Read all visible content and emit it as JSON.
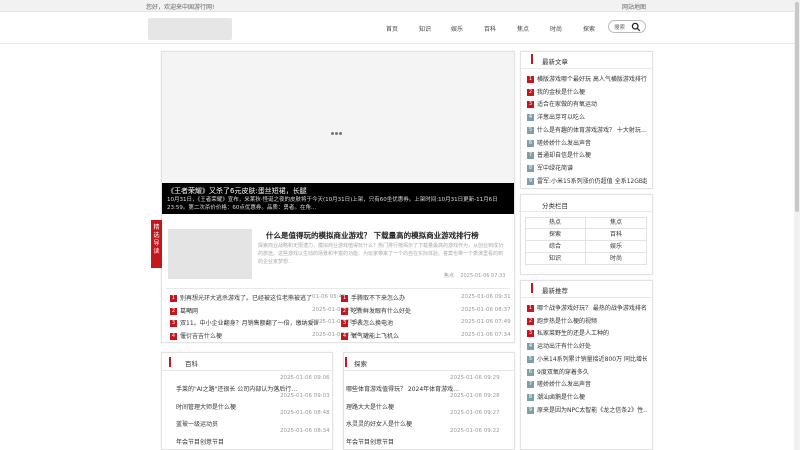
{
  "topbar": {
    "welcome": "您好，欢迎来中国游行网!",
    "sitemap": "网站地图"
  },
  "nav": {
    "items": [
      "首页",
      "知识",
      "娱乐",
      "百科",
      "焦点",
      "时尚",
      "探索"
    ]
  },
  "search": {
    "label": "搜索"
  },
  "slider": {
    "title": "《王者荣耀》又杀了6元皮肤:蛋丝短裙，长腿",
    "desc": "10月31日，《王者荣耀》宣布，米莱狄·怪诞之夜的皮肤将于今天(10月31日)上架，只有60坐优惠券。上架时间:10月31日更新-11月6日23:59。第二次杀价价格：60点优惠券。品质：勇者。在角…"
  },
  "featured": {
    "badge": "精选导读",
    "title": "什么是值得玩的模拟商业游戏？ 下载量高的模拟商业游戏排行榜",
    "desc": "探索商业战略和无限潜力，模拟商业游戏值得玩什么？热门排行榜揭示了下载量最高的游戏作为，从创业到成功的旅途。这些游戏以生动的场景和丰富的功能、为玩家带来了一个的自在实际体验。答案也带一个表演里看的到的企业家梦想…",
    "tag": "焦点",
    "date": "2025-01-06 07:33"
  },
  "left_news": [
    {
      "n": "1",
      "text": "别再想光环大逃杀游戏了。已经被这位老熊被逃了",
      "date": "01-06 05:45"
    },
    {
      "n": "2",
      "text": "葛嗮网",
      "date": "2025-01-06 08:45"
    },
    {
      "n": "3",
      "text": "双11。中小企业翻身？月销售额翻了一倍，缴纳爱国",
      "date": "2025-01-06 08:17"
    },
    {
      "n": "4",
      "text": "偃衍吉吉什么梗",
      "date": "2025-01-06 07:45"
    }
  ],
  "right_news": [
    {
      "n": "1",
      "text": "手腾取不下来怎么办",
      "date": "2025-01-06 09:31"
    },
    {
      "n": "2",
      "text": "吃新鲜发眼有什么好处",
      "date": "2025-01-06 08:37"
    },
    {
      "n": "3",
      "text": "手表怎么换电池",
      "date": "2025-01-06 07:49"
    },
    {
      "n": "4",
      "text": "氧气罐能上飞机么",
      "date": "2025-01-06 07:34"
    }
  ],
  "section_baike": {
    "title": "百科",
    "items": [
      {
        "date": "2025-01-06 09:06",
        "text": "手莱的\"AI之路\"还很长 公司内部认为落后行…"
      },
      {
        "date": "2025-01-06 09:03",
        "text": "时间管理大师是什么梗"
      },
      {
        "date": "2025-01-06 08:48",
        "text": "蓝玻一级运动员"
      },
      {
        "date": "2025-01-06 08:34",
        "text": "年会节目创意节目"
      }
    ]
  },
  "section_tansuo": {
    "title": "探索",
    "items": [
      {
        "date": "2025-01-06 09:29",
        "text": "哪些体育游戏值得玩？ 2024年体育游戏…"
      },
      {
        "date": "2025-01-06 09:28",
        "text": "理路大大是什么梗"
      },
      {
        "date": "2025-01-06 09:27",
        "text": "水灵灵的好女人是什么梗"
      },
      {
        "date": "2025-01-06 09:22",
        "text": "年会节目创意节目"
      }
    ]
  },
  "latest": {
    "title": "最新文章",
    "items": [
      {
        "n": "1",
        "text": "横版游戏哪个最好玩 高人气横版游戏排行"
      },
      {
        "n": "2",
        "text": "我的金秋是什么梗"
      },
      {
        "n": "3",
        "text": "适合在家做的有氧运动"
      },
      {
        "n": "4",
        "text": "洋葱出芽可以吃么"
      },
      {
        "n": "5",
        "text": "什么是有趣的体育游戏游戏？ 十大射玩…"
      },
      {
        "n": "6",
        "text": "嗟娇娇什么发出声音"
      },
      {
        "n": "7",
        "text": "普通却自信是什么梗"
      },
      {
        "n": "8",
        "text": "军中绿花简谱"
      },
      {
        "n": "9",
        "text": "雷军:小米15系列涨价仍超值 全系12GB起"
      }
    ]
  },
  "categories": {
    "title": "分类栏目",
    "cells": [
      "热点",
      "焦点",
      "探索",
      "百科",
      "综合",
      "娱乐",
      "知识",
      "时尚"
    ]
  },
  "recommend": {
    "title": "最新推荐",
    "items": [
      {
        "n": "1",
        "text": "哪个战争游戏好玩？ 最热的战争游戏排名"
      },
      {
        "n": "2",
        "text": "跑步热是什么梗的视频"
      },
      {
        "n": "3",
        "text": "私家菜野生的还是人工种的"
      },
      {
        "n": "4",
        "text": "运动出汗有什么好处"
      },
      {
        "n": "5",
        "text": "小米14系列累计销量接近800万 同比增长…"
      },
      {
        "n": "6",
        "text": "9度双氧的穿着多久"
      },
      {
        "n": "7",
        "text": "嗟娇娇什么发出声音"
      },
      {
        "n": "8",
        "text": "潮汕卤鹅是什么梗"
      },
      {
        "n": "9",
        "text": "原来是因为NPC太智能《龙之信条2》性…"
      }
    ]
  },
  "colors": {
    "accent": "#c4161c",
    "num_gray": "#7f9fa6"
  }
}
